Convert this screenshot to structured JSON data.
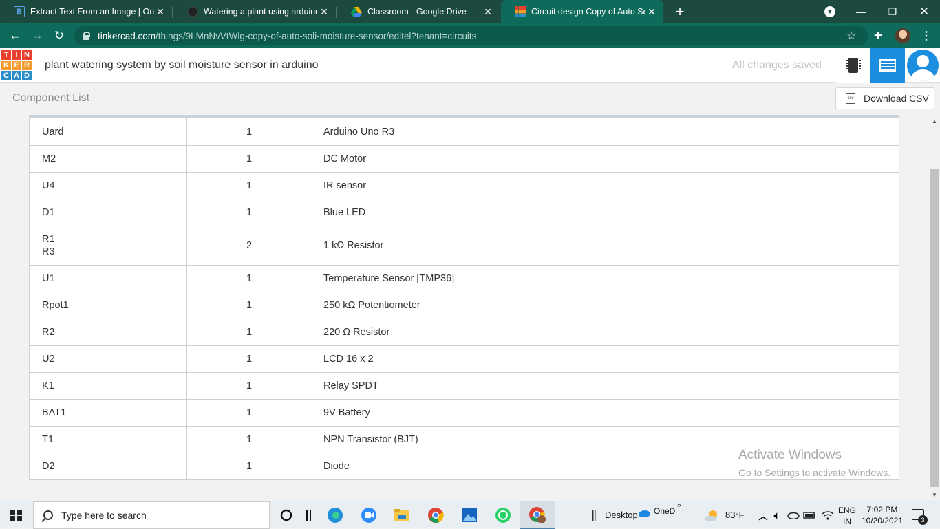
{
  "browser": {
    "tabs": [
      {
        "title": "Extract Text From an Image | Onli",
        "favicon": "B",
        "active": false
      },
      {
        "title": "Watering a plant using arduino -",
        "favicon": "instructables-icon",
        "active": false
      },
      {
        "title": "Classroom - Google Drive",
        "favicon": "drive-icon",
        "active": false
      },
      {
        "title": "Circuit design Copy of Auto Soli",
        "favicon": "tinkercad-icon",
        "active": true
      }
    ],
    "url_host": "tinkercad.com",
    "url_path": "/things/9LMnNvVtWlg-copy-of-auto-soli-moisture-sensor/editel?tenant=circuits",
    "colors": {
      "tabstrip": "#1d4a3f",
      "toolbar": "#0e6b5c"
    }
  },
  "app": {
    "logo_letters": [
      "T",
      "I",
      "N",
      "K",
      "E",
      "R",
      "C",
      "A",
      "D"
    ],
    "project_title": "plant watering system by soil moisture sensor in arduino",
    "save_status": "All changes saved",
    "accent": "#1b8ee0"
  },
  "component_list": {
    "title": "Component List",
    "download_label": "Download CSV",
    "csv_icon_text": "csv",
    "rows": [
      {
        "refs": [
          "Uard"
        ],
        "qty": "1",
        "name": "Arduino Uno R3"
      },
      {
        "refs": [
          "M2"
        ],
        "qty": "1",
        "name": "DC Motor"
      },
      {
        "refs": [
          "U4"
        ],
        "qty": "1",
        "name": "IR sensor"
      },
      {
        "refs": [
          "D1"
        ],
        "qty": "1",
        "name": "Blue LED"
      },
      {
        "refs": [
          "R1",
          "R3"
        ],
        "qty": "2",
        "name": "1 kΩ Resistor"
      },
      {
        "refs": [
          "U1"
        ],
        "qty": "1",
        "name": "Temperature Sensor [TMP36]"
      },
      {
        "refs": [
          "Rpot1"
        ],
        "qty": "1",
        "name": "250 kΩ Potentiometer"
      },
      {
        "refs": [
          "R2"
        ],
        "qty": "1",
        "name": "220 Ω Resistor"
      },
      {
        "refs": [
          "U2"
        ],
        "qty": "1",
        "name": "LCD 16 x 2"
      },
      {
        "refs": [
          "K1"
        ],
        "qty": "1",
        "name": "Relay SPDT"
      },
      {
        "refs": [
          "BAT1"
        ],
        "qty": "1",
        "name": "9V Battery"
      },
      {
        "refs": [
          "T1"
        ],
        "qty": "1",
        "name": "NPN Transistor (BJT)"
      },
      {
        "refs": [
          "D2"
        ],
        "qty": "1",
        "name": "Diode"
      }
    ]
  },
  "watermark": {
    "line1": "Activate Windows",
    "line2": "Go to Settings to activate Windows."
  },
  "taskbar": {
    "search_placeholder": "Type here to search",
    "desktop_label": "Desktop",
    "onedrive_label": "OneD",
    "weather": "83°F",
    "lang_top": "ENG",
    "lang_bottom": "IN",
    "time": "7:02 PM",
    "date": "10/20/2021",
    "notification_count": "3"
  }
}
